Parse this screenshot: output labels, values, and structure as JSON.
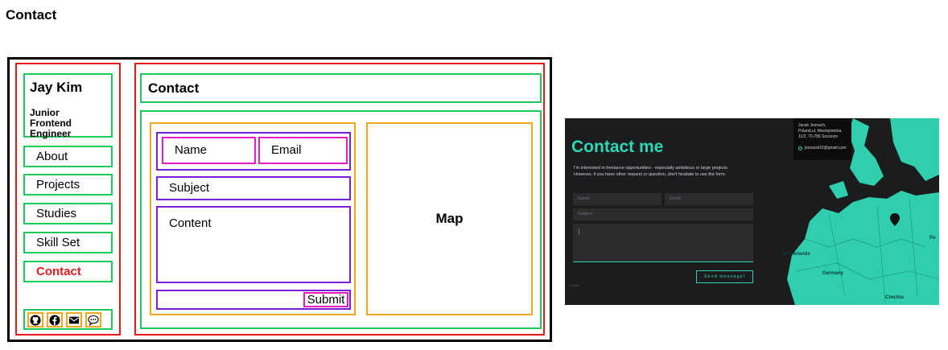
{
  "page": {
    "title": "Contact"
  },
  "wireframe": {
    "profile": {
      "name": "Jay Kim",
      "role_line1": "Junior",
      "role_line2": "Frontend Engineer"
    },
    "nav": [
      {
        "label": "About",
        "active": false
      },
      {
        "label": "Projects",
        "active": false
      },
      {
        "label": "Studies",
        "active": false
      },
      {
        "label": "Skill Set",
        "active": false
      },
      {
        "label": "Contact",
        "active": true
      }
    ],
    "social_icons": [
      "github-icon",
      "facebook-icon",
      "email-icon",
      "chat-icon"
    ],
    "header": "Contact",
    "form": {
      "name": "Name",
      "email": "Email",
      "subject": "Subject",
      "content": "Content",
      "submit": "Submit"
    },
    "map": "Map"
  },
  "screenshot": {
    "title": "Contact me",
    "description_line1": "I'm interested in freelance opportunities - especially ambitious or large projects.",
    "description_line2": "However, if you have other request or question, don't hesitate to use the form.",
    "name_placeholder": "Name",
    "email_placeholder": "Email",
    "subject_placeholder": "Subject",
    "send_label": "Send message!",
    "side_text": "</body>",
    "card": {
      "line1": "Jacek Jeznach,",
      "line2": "Poland,ul. Maciejowicka",
      "line3": "11/2, 70-786 Szczecin",
      "email": "jeznacki15@gmail.com"
    },
    "map_labels": {
      "germany": "Germany",
      "czechia": "Czechia",
      "netherlands": "Netherlands",
      "pol": "Po"
    }
  },
  "colors": {
    "accent": "#2fd6b6",
    "wire_red": "#e8191d",
    "wire_green": "#1fc85b",
    "wire_orange": "#f2a81c",
    "wire_purple": "#7a1fd8",
    "wire_magenta": "#e51bbf"
  }
}
